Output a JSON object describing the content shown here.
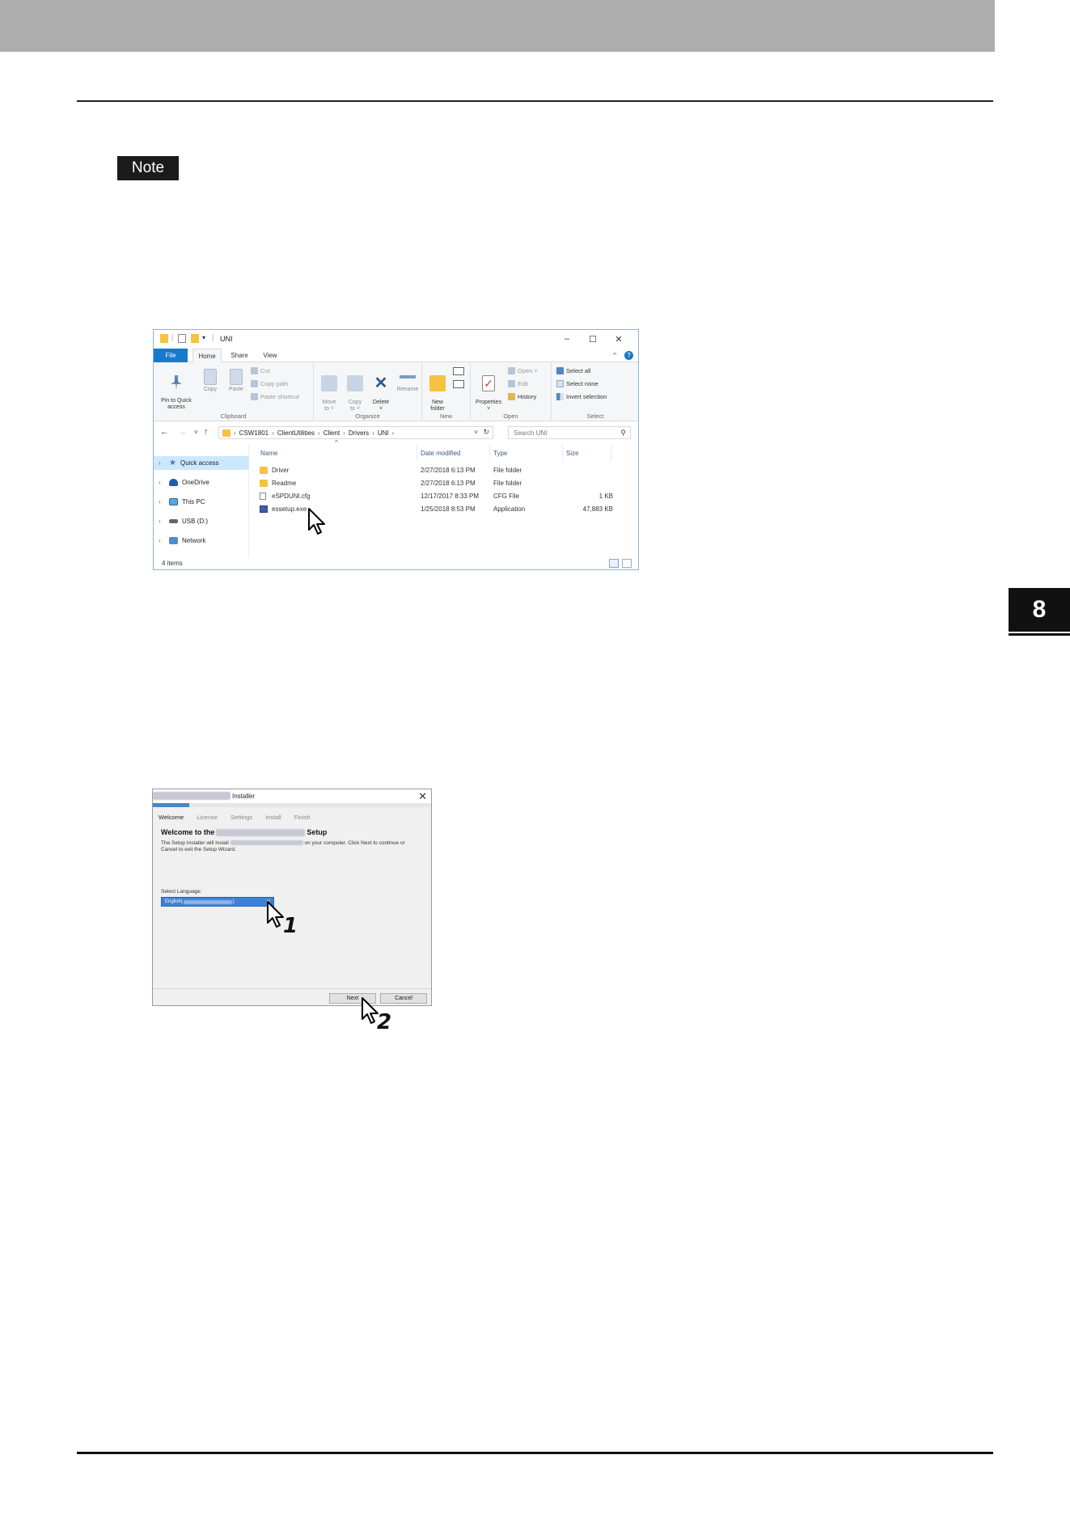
{
  "page": {
    "note_label": "Note",
    "chapter_number": "8"
  },
  "explorer": {
    "title": "UNI",
    "tabs": {
      "file": "File",
      "home": "Home",
      "share": "Share",
      "view": "View"
    },
    "ribbon": {
      "clipboard": {
        "label": "Clipboard",
        "pin_to_quick_access": "Pin to Quick\naccess",
        "copy": "Copy",
        "paste": "Paste",
        "cut": "Cut",
        "copy_path": "Copy path",
        "paste_shortcut": "Paste shortcut"
      },
      "organize": {
        "label": "Organize",
        "move_to": "Move\nto ˅",
        "copy_to": "Copy\nto ˅",
        "delete": "Delete\n˅",
        "rename": "Rename"
      },
      "new": {
        "label": "New",
        "new_folder": "New\nfolder"
      },
      "open": {
        "label": "Open",
        "properties": "Properties\n˅",
        "open": "Open ˅",
        "edit": "Edit",
        "history": "History"
      },
      "select": {
        "label": "Select",
        "select_all": "Select all",
        "select_none": "Select none",
        "invert_selection": "Invert selection"
      }
    },
    "address": {
      "crumbs": [
        "CSW1801",
        "ClientUtilities",
        "Client",
        "Drivers",
        "UNI"
      ],
      "search_placeholder": "Search UNI"
    },
    "nav": [
      {
        "label": "Quick access",
        "icon": "star-icon"
      },
      {
        "label": "OneDrive",
        "icon": "cloud-icon"
      },
      {
        "label": "This PC",
        "icon": "computer-icon"
      },
      {
        "label": "USB (D:)",
        "icon": "drive-icon"
      },
      {
        "label": "Network",
        "icon": "network-icon"
      }
    ],
    "columns": {
      "name": "Name",
      "date_modified": "Date modified",
      "type": "Type",
      "size": "Size"
    },
    "files": [
      {
        "name": "Driver",
        "date": "2/27/2018 6:13 PM",
        "type": "File folder",
        "size": "",
        "icon": "folder-icon"
      },
      {
        "name": "Readme",
        "date": "2/27/2018 6:13 PM",
        "type": "File folder",
        "size": "",
        "icon": "folder-icon"
      },
      {
        "name": "eSPDUNI.cfg",
        "date": "12/17/2017 8:33 PM",
        "type": "CFG File",
        "size": "1 KB",
        "icon": "document-icon"
      },
      {
        "name": "essetup.exe",
        "date": "1/25/2018 8:53 PM",
        "type": "Application",
        "size": "47,883 KB",
        "icon": "application-icon"
      }
    ],
    "status": "4 items"
  },
  "installer": {
    "title_suffix": "Installer",
    "steps": [
      "Welcome",
      "License",
      "Settings",
      "Install",
      "Finish"
    ],
    "active_step": "Welcome",
    "progress_fraction": 0.13,
    "heading_prefix": "Welcome to the",
    "heading_suffix": "Setup",
    "desc_part1": "The Setup Installer will install",
    "desc_part2": "on your computer. Click Next to continue or",
    "desc_part3": "Cancel to exit the Setup Wizard.",
    "language_label": "Select Language:",
    "language_value": "English(",
    "next_button": "Next",
    "cancel_button": "Cancel",
    "callout_1": "1",
    "callout_2": "2"
  }
}
